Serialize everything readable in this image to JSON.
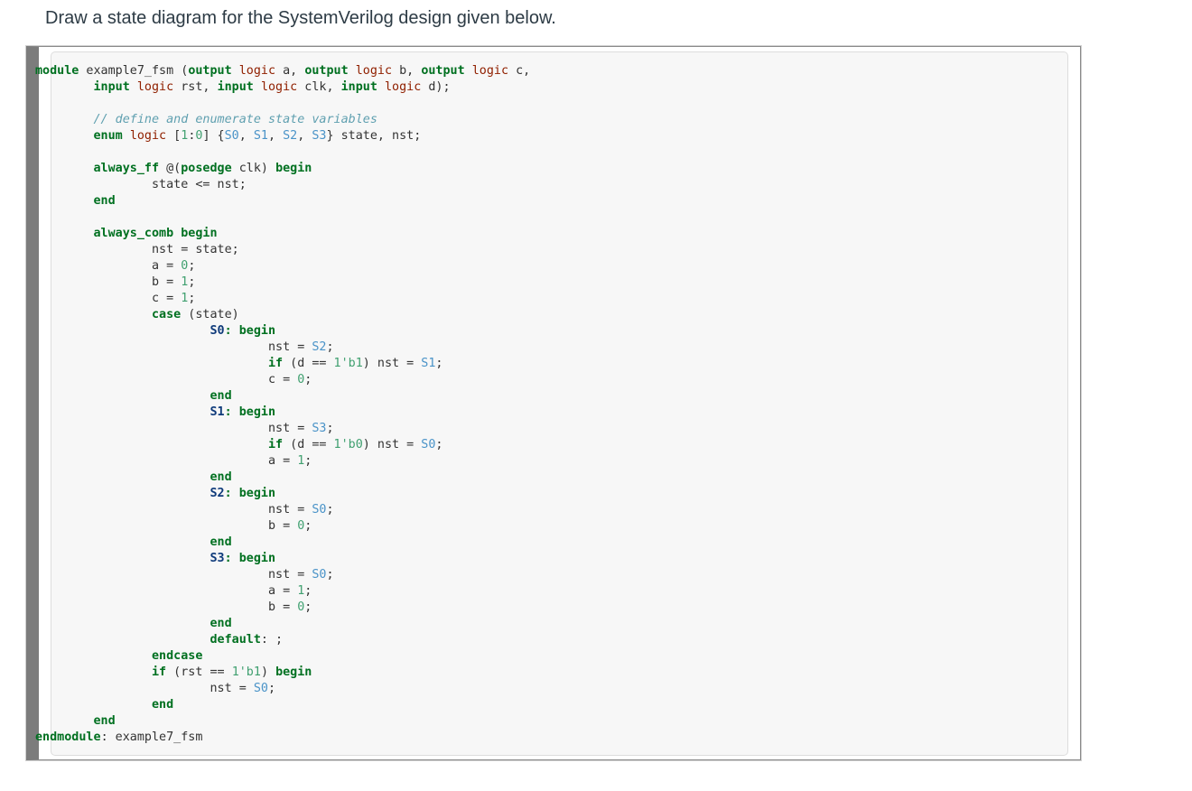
{
  "question": "Draw a state diagram for the SystemVerilog design given below.",
  "code_lines": [
    [
      [
        "kw",
        "module"
      ],
      [
        "",
        " example7_fsm ("
      ],
      [
        "kw",
        "output"
      ],
      [
        "",
        " "
      ],
      [
        "ty",
        "logic"
      ],
      [
        "",
        " a, "
      ],
      [
        "kw",
        "output"
      ],
      [
        "",
        " "
      ],
      [
        "ty",
        "logic"
      ],
      [
        "",
        " b, "
      ],
      [
        "kw",
        "output"
      ],
      [
        "",
        " "
      ],
      [
        "ty",
        "logic"
      ],
      [
        "",
        " c,"
      ]
    ],
    [
      [
        "",
        "        "
      ],
      [
        "kw",
        "input"
      ],
      [
        "",
        " "
      ],
      [
        "ty",
        "logic"
      ],
      [
        "",
        " rst, "
      ],
      [
        "kw",
        "input"
      ],
      [
        "",
        " "
      ],
      [
        "ty",
        "logic"
      ],
      [
        "",
        " clk, "
      ],
      [
        "kw",
        "input"
      ],
      [
        "",
        " "
      ],
      [
        "ty",
        "logic"
      ],
      [
        "",
        " d);"
      ]
    ],
    [],
    [
      [
        "",
        "        "
      ],
      [
        "cm",
        "// define and enumerate state variables"
      ]
    ],
    [
      [
        "",
        "        "
      ],
      [
        "kw",
        "enum"
      ],
      [
        "",
        " "
      ],
      [
        "ty",
        "logic"
      ],
      [
        "",
        " ["
      ],
      [
        "num",
        "1"
      ],
      [
        "",
        ":"
      ],
      [
        "num",
        "0"
      ],
      [
        "",
        "] {"
      ],
      [
        "st",
        "S0"
      ],
      [
        "",
        ", "
      ],
      [
        "st",
        "S1"
      ],
      [
        "",
        ", "
      ],
      [
        "st",
        "S2"
      ],
      [
        "",
        ", "
      ],
      [
        "st",
        "S3"
      ],
      [
        "",
        "} state, nst;"
      ]
    ],
    [],
    [
      [
        "",
        "        "
      ],
      [
        "kw",
        "always_ff"
      ],
      [
        "",
        " @("
      ],
      [
        "kw",
        "posedge"
      ],
      [
        "",
        " clk) "
      ],
      [
        "kw",
        "begin"
      ]
    ],
    [
      [
        "",
        "                state <= nst;"
      ]
    ],
    [
      [
        "",
        "        "
      ],
      [
        "kw",
        "end"
      ]
    ],
    [],
    [
      [
        "",
        "        "
      ],
      [
        "kw",
        "always_comb"
      ],
      [
        "",
        " "
      ],
      [
        "kw",
        "begin"
      ]
    ],
    [
      [
        "",
        "                nst = state;"
      ]
    ],
    [
      [
        "",
        "                a = "
      ],
      [
        "num",
        "0"
      ],
      [
        "",
        ";"
      ]
    ],
    [
      [
        "",
        "                b = "
      ],
      [
        "num",
        "1"
      ],
      [
        "",
        ";"
      ]
    ],
    [
      [
        "",
        "                c = "
      ],
      [
        "num",
        "1"
      ],
      [
        "",
        ";"
      ]
    ],
    [
      [
        "",
        "                "
      ],
      [
        "kw",
        "case"
      ],
      [
        "",
        " (state)"
      ]
    ],
    [
      [
        "",
        "                        "
      ],
      [
        "lbl",
        "S0"
      ],
      [
        "kw",
        ": begin"
      ]
    ],
    [
      [
        "",
        "                                nst = "
      ],
      [
        "st",
        "S2"
      ],
      [
        "",
        ";"
      ]
    ],
    [
      [
        "",
        "                                "
      ],
      [
        "kw",
        "if"
      ],
      [
        "",
        " (d == "
      ],
      [
        "num",
        "1'b1"
      ],
      [
        "",
        ") nst = "
      ],
      [
        "st",
        "S1"
      ],
      [
        "",
        ";"
      ]
    ],
    [
      [
        "",
        "                                c = "
      ],
      [
        "num",
        "0"
      ],
      [
        "",
        ";"
      ]
    ],
    [
      [
        "",
        "                        "
      ],
      [
        "kw",
        "end"
      ]
    ],
    [
      [
        "",
        "                        "
      ],
      [
        "lbl",
        "S1"
      ],
      [
        "kw",
        ": begin"
      ]
    ],
    [
      [
        "",
        "                                nst = "
      ],
      [
        "st",
        "S3"
      ],
      [
        "",
        ";"
      ]
    ],
    [
      [
        "",
        "                                "
      ],
      [
        "kw",
        "if"
      ],
      [
        "",
        " (d == "
      ],
      [
        "num",
        "1'b0"
      ],
      [
        "",
        ") nst = "
      ],
      [
        "st",
        "S0"
      ],
      [
        "",
        ";"
      ]
    ],
    [
      [
        "",
        "                                a = "
      ],
      [
        "num",
        "1"
      ],
      [
        "",
        ";"
      ]
    ],
    [
      [
        "",
        "                        "
      ],
      [
        "kw",
        "end"
      ]
    ],
    [
      [
        "",
        "                        "
      ],
      [
        "lbl",
        "S2"
      ],
      [
        "kw",
        ": begin"
      ]
    ],
    [
      [
        "",
        "                                nst = "
      ],
      [
        "st",
        "S0"
      ],
      [
        "",
        ";"
      ]
    ],
    [
      [
        "",
        "                                b = "
      ],
      [
        "num",
        "0"
      ],
      [
        "",
        ";"
      ]
    ],
    [
      [
        "",
        "                        "
      ],
      [
        "kw",
        "end"
      ]
    ],
    [
      [
        "",
        "                        "
      ],
      [
        "lbl",
        "S3"
      ],
      [
        "kw",
        ": begin"
      ]
    ],
    [
      [
        "",
        "                                nst = "
      ],
      [
        "st",
        "S0"
      ],
      [
        "",
        ";"
      ]
    ],
    [
      [
        "",
        "                                a = "
      ],
      [
        "num",
        "1"
      ],
      [
        "",
        ";"
      ]
    ],
    [
      [
        "",
        "                                b = "
      ],
      [
        "num",
        "0"
      ],
      [
        "",
        ";"
      ]
    ],
    [
      [
        "",
        "                        "
      ],
      [
        "kw",
        "end"
      ]
    ],
    [
      [
        "",
        "                        "
      ],
      [
        "kw",
        "default"
      ],
      [
        "",
        ": ;"
      ]
    ],
    [
      [
        "",
        "                "
      ],
      [
        "kw",
        "endcase"
      ]
    ],
    [
      [
        "",
        "                "
      ],
      [
        "kw",
        "if"
      ],
      [
        "",
        " (rst == "
      ],
      [
        "num",
        "1'b1"
      ],
      [
        "",
        ") "
      ],
      [
        "kw",
        "begin"
      ]
    ],
    [
      [
        "",
        "                        nst = "
      ],
      [
        "st",
        "S0"
      ],
      [
        "",
        ";"
      ]
    ],
    [
      [
        "",
        "                "
      ],
      [
        "kw",
        "end"
      ]
    ],
    [
      [
        "",
        "        "
      ],
      [
        "kw",
        "end"
      ]
    ],
    [
      [
        "kw",
        "endmodule"
      ],
      [
        "",
        ": example7_fsm"
      ]
    ]
  ]
}
